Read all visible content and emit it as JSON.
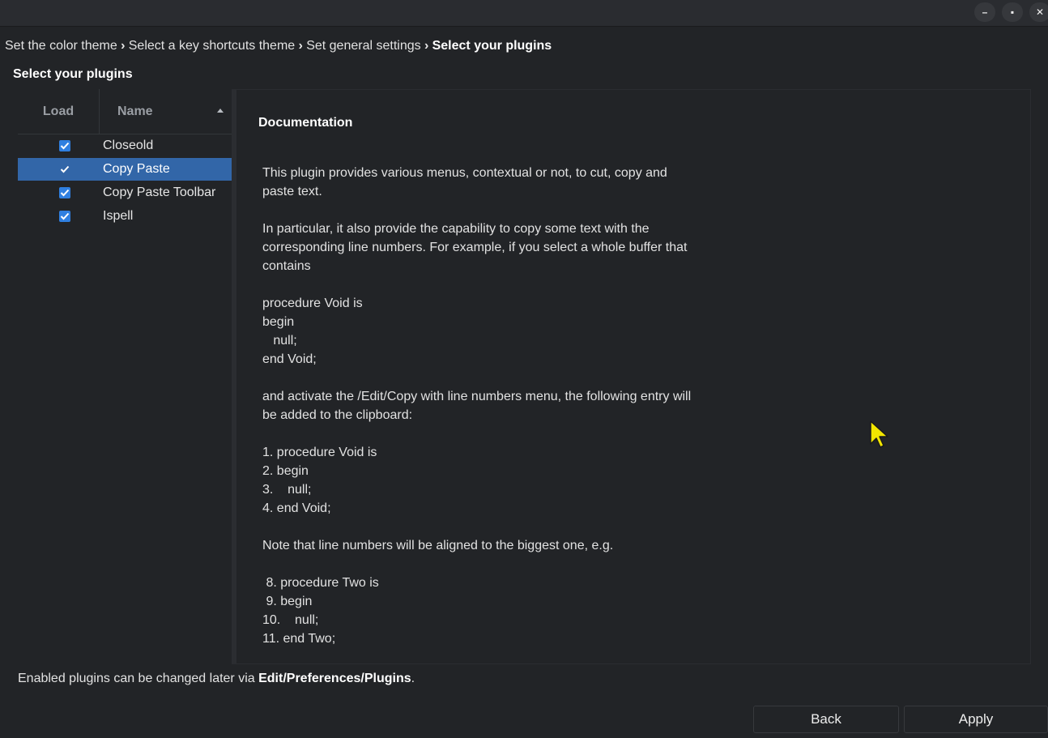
{
  "window": {
    "controls": [
      {
        "name": "minimize-icon",
        "glyph": "–"
      },
      {
        "name": "maximize-icon",
        "glyph": "▪"
      },
      {
        "name": "close-icon",
        "glyph": "✕"
      }
    ]
  },
  "breadcrumb": {
    "steps": [
      "Set the color theme",
      "Select a key shortcuts theme",
      "Set general settings",
      "Select your plugins"
    ],
    "separator_icon": "chevron-right-icon"
  },
  "section_title": "Select your plugins",
  "plugin_list": {
    "columns": {
      "load": "Load",
      "name": "Name"
    },
    "sort": {
      "column": "Name",
      "direction": "ascending"
    },
    "rows": [
      {
        "name": "Closeold",
        "loaded": true,
        "selected": false
      },
      {
        "name": "Copy Paste",
        "loaded": true,
        "selected": true
      },
      {
        "name": "Copy Paste Toolbar",
        "loaded": true,
        "selected": false
      },
      {
        "name": "Ispell",
        "loaded": true,
        "selected": false
      }
    ]
  },
  "documentation": {
    "heading": "Documentation",
    "body": "This plugin provides various menus, contextual or not, to cut, copy and\npaste text.\n\nIn particular, it also provide the capability to copy some text with the\ncorresponding line numbers. For example, if you select a whole buffer that\ncontains\n\nprocedure Void is\nbegin\n   null;\nend Void;\n\nand activate the /Edit/Copy with line numbers menu, the following entry will\nbe added to the clipboard:\n\n1. procedure Void is\n2. begin\n3.    null;\n4. end Void;\n\nNote that line numbers will be aligned to the biggest one, e.g.\n\n 8. procedure Two is\n 9. begin\n10.    null;\n11. end Two;"
  },
  "footer": {
    "note_prefix": "Enabled plugins can be changed later via ",
    "note_path": "Edit/Preferences/Plugins",
    "note_suffix": "."
  },
  "buttons": {
    "back": "Back",
    "apply": "Apply"
  },
  "colors": {
    "selection": "#3266a8",
    "checkbox": "#2f7fe0",
    "background": "#222427"
  }
}
